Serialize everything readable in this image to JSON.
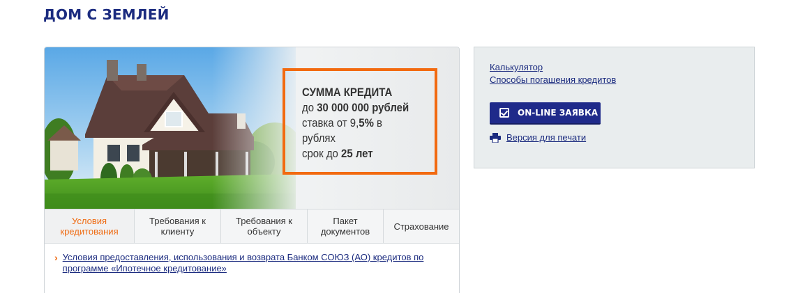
{
  "page": {
    "title": "ДОМ С ЗЕМЛЕЙ"
  },
  "banner": {
    "heading": "СУММА КРЕДИТА",
    "line1_prefix": "до ",
    "line1_value": "30 000 000 рублей",
    "line2_prefix": "ставка от 9,",
    "line2_value": "5%",
    "line2_suffix": " в",
    "line3": "рублях",
    "line4_prefix": "срок до ",
    "line4_value": "25 лет",
    "accent_color": "#f26a10"
  },
  "tabs": [
    {
      "label": "Условия кредитования",
      "active": true
    },
    {
      "label": "Требования к клиенту",
      "active": false
    },
    {
      "label": "Требования к объекту",
      "active": false
    },
    {
      "label": "Пакет документов",
      "active": false
    },
    {
      "label": "Страхование",
      "active": false
    }
  ],
  "content": {
    "doc_link": "Условия предоставления, использования и возврата Банком СОЮЗ (АО) кредитов по программе «Ипотечное кредитование»"
  },
  "sidebar": {
    "links": [
      "Калькулятор",
      "Способы погашения кредитов"
    ],
    "online_button": "ON-LINE ЗАЯВКА",
    "print_link": "Версия для печати"
  },
  "colors": {
    "brand_blue": "#1b2b7f",
    "button_blue": "#1f2a8a",
    "orange": "#ef6b12"
  }
}
